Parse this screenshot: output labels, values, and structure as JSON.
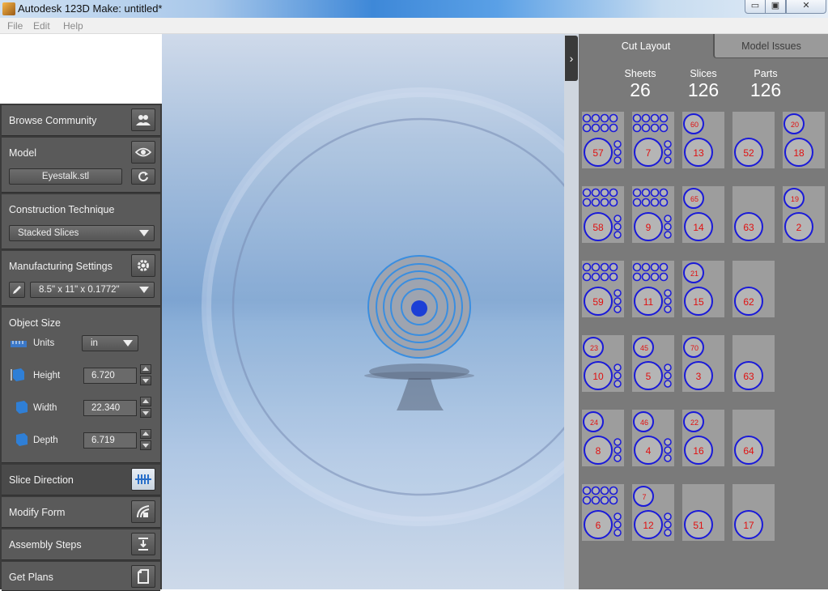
{
  "window": {
    "title": "Autodesk 123D Make: untitled*",
    "min_label": "▭",
    "max_label": "▣",
    "close_label": "✕"
  },
  "menu": [
    "File",
    "Edit",
    "Help"
  ],
  "left_panel": {
    "browse_community": "Browse Community",
    "model_label": "Model",
    "model_file": "Eyestalk.stl",
    "construction_label": "Construction Technique",
    "construction_value": "Stacked Slices",
    "manufacturing_label": "Manufacturing Settings",
    "manufacturing_value": "8.5\" x 11\" x 0.1772\"",
    "object_size_label": "Object Size",
    "units_label": "Units",
    "units_value": "in",
    "height_label": "Height",
    "height_value": "6.720",
    "width_label": "Width",
    "width_value": "22.340",
    "depth_label": "Depth",
    "depth_value": "6.719",
    "slice_direction": "Slice Direction",
    "modify_form": "Modify Form",
    "assembly_steps": "Assembly Steps",
    "get_plans": "Get Plans"
  },
  "right_panel": {
    "collapse_icon": "›",
    "tab_cut_layout": "Cut Layout",
    "tab_model_issues": "Model Issues",
    "sheets_label": "Sheets",
    "sheets_value": "26",
    "slices_label": "Slices",
    "slices_value": "126",
    "parts_label": "Parts",
    "parts_value": "126",
    "sheets": [
      [
        {
          "big": "57"
        },
        {
          "big": "7"
        },
        {
          "big": "13",
          "top": "60"
        },
        {
          "big": "52"
        },
        {
          "big": "18",
          "top": "20"
        }
      ],
      [
        {
          "big": "58"
        },
        {
          "big": "9"
        },
        {
          "big": "14",
          "top": "65"
        },
        {
          "big": "63"
        },
        {
          "big": "2",
          "top": "19"
        }
      ],
      [
        {
          "big": "59"
        },
        {
          "big": "11"
        },
        {
          "big": "15",
          "top": "21"
        },
        {
          "big": "62"
        },
        null
      ],
      [
        {
          "big": "10",
          "top": "23"
        },
        {
          "big": "5",
          "top": "45"
        },
        {
          "big": "3",
          "top": "70"
        },
        {
          "big": "63"
        },
        null
      ],
      [
        {
          "big": "8",
          "top": "24"
        },
        {
          "big": "4",
          "top": "46"
        },
        {
          "big": "16",
          "top": "22"
        },
        {
          "big": "64"
        },
        null
      ],
      [
        {
          "big": "6"
        },
        {
          "big": "12",
          "top": "7"
        },
        {
          "big": "51"
        },
        {
          "big": "17"
        },
        null
      ]
    ]
  },
  "colors": {
    "panel_dark": "#3b3b3b",
    "section": "#5a5a5a",
    "right_panel": "#7a7a7a",
    "sheet": "#9d9d9d",
    "part_outline": "#1a1ad8",
    "part_label": "#e01010"
  }
}
